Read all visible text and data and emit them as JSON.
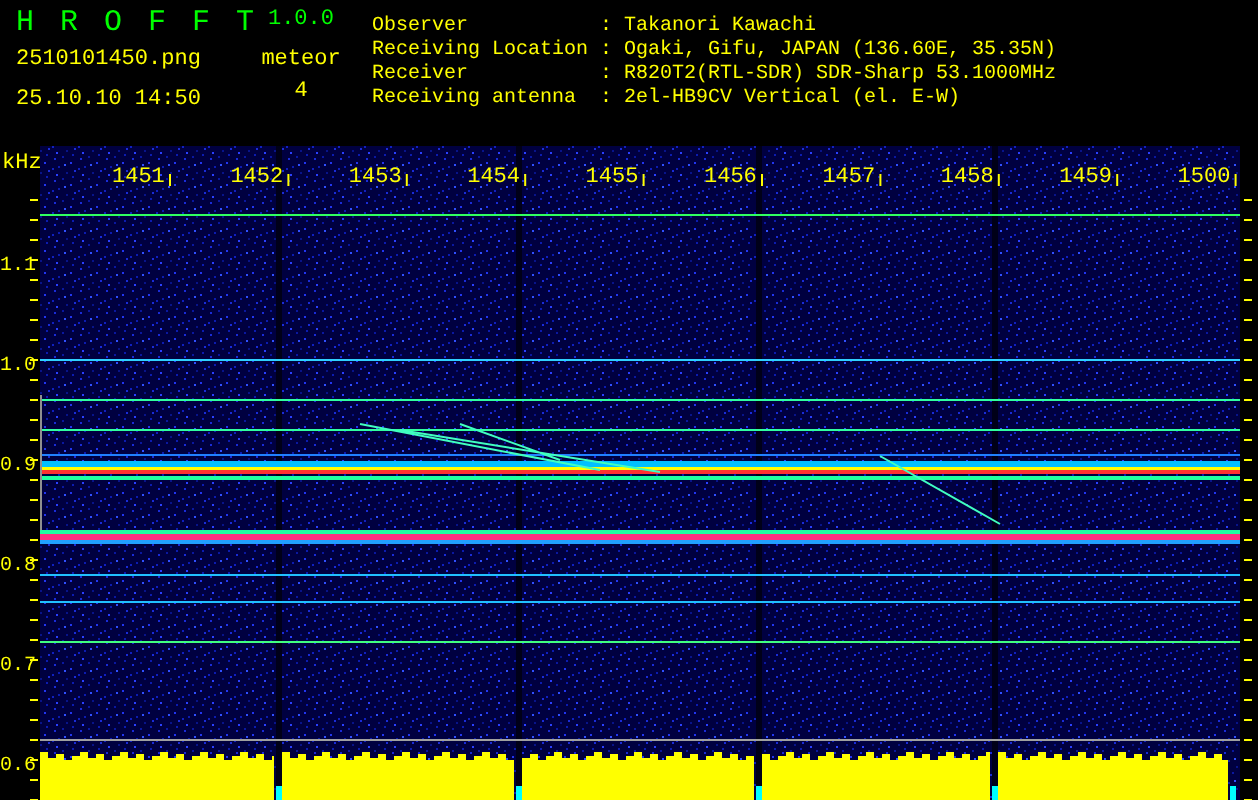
{
  "app": {
    "name": "HROFFT",
    "version": "1.0.0"
  },
  "file": "2510101450.png",
  "datetime": "25.10.10 14:50",
  "meteor": {
    "label": "meteor",
    "count": "4"
  },
  "station": [
    {
      "label": "Observer",
      "value": ": Takanori Kawachi"
    },
    {
      "label": "Receiving Location",
      "value": ": Ogaki, Gifu, JAPAN (136.60E, 35.35N)"
    },
    {
      "label": "Receiver",
      "value": ": R820T2(RTL-SDR) SDR-Sharp 53.1000MHz"
    },
    {
      "label": "Receiving antenna",
      "value": ": 2el-HB9CV Vertical (el. E-W)"
    }
  ],
  "plot": {
    "unit": "kHz",
    "time_labels": [
      "1451",
      "1452",
      "1453",
      "1454",
      "1455",
      "1456",
      "1457",
      "1458",
      "1459",
      "1500"
    ],
    "freq_labels": [
      "1.1",
      "1.0",
      "0.9",
      "0.8",
      "0.7",
      "0.6"
    ]
  }
}
